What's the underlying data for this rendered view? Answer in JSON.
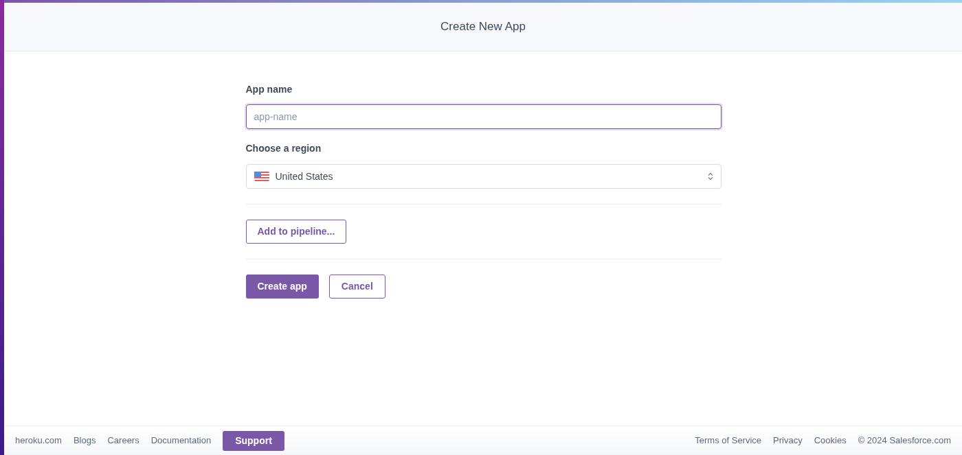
{
  "header": {
    "title": "Create New App"
  },
  "form": {
    "app_name": {
      "label": "App name",
      "placeholder": "app-name"
    },
    "region": {
      "label": "Choose a region",
      "value": "United States"
    },
    "pipeline_button": "Add to pipeline...",
    "buttons": [
      {
        "label": "Create app",
        "kind": "primary"
      },
      {
        "label": "Cancel",
        "kind": "secondary"
      }
    ]
  },
  "footer": {
    "left": [
      {
        "label": "heroku.com",
        "kind": "link"
      },
      {
        "label": "Blogs",
        "kind": "link"
      },
      {
        "label": "Careers",
        "kind": "link"
      },
      {
        "label": "Documentation",
        "kind": "link"
      },
      {
        "label": "Support",
        "kind": "button"
      }
    ],
    "right": [
      "Terms of Service",
      "Privacy",
      "Cookies"
    ],
    "copyright": "© 2024 Salesforce.com"
  }
}
